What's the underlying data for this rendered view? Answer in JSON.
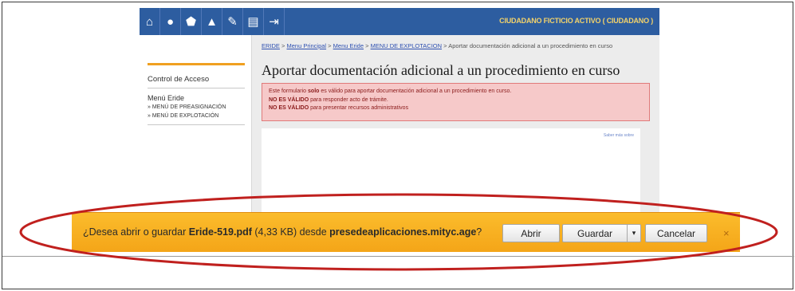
{
  "page": {
    "user_label": "CIUDADANO FICTICIO ACTIVO ( CIUDADANO )",
    "nav_icons": [
      "home-icon",
      "info-icon",
      "services-icon",
      "warning-icon",
      "edit-icon",
      "document-icon",
      "exit-icon"
    ],
    "nav_glyphs": [
      "⌂",
      "●",
      "⬟",
      "▲",
      "✎",
      "▤",
      "⇥"
    ]
  },
  "sidebar": {
    "access_control": "Control de Acceso",
    "menu_title": "Menú Eride",
    "menu_items": [
      "» MENÚ DE PREASIGNACIÓN",
      "» MENÚ DE EXPLOTACIÓN"
    ]
  },
  "breadcrumb": {
    "link1": "ERIDE",
    "link2": "Menu Principal",
    "link3": "Menu Eride",
    "link4": "MENU DE EXPLOTACION",
    "sep": " > ",
    "current": "Aportar documentación adicional a un procedimiento en curso"
  },
  "main": {
    "title": "Aportar documentación adicional a un procedimiento en curso",
    "alert": {
      "line1_pre": "Este formulario ",
      "line1_bold": "solo",
      "line1_post": " es válido para aportar documentación adicional a un procedimiento en curso.",
      "line2_bold": "NO ES VÁLIDO",
      "line2_post": " para responder acto de trámite.",
      "line3_bold": "NO ES VÁLIDO",
      "line3_post": " para presentar recursos administrativos"
    },
    "inner_link": "Saber más sobre"
  },
  "download_bar": {
    "prefix": "¿Desea abrir o guardar ",
    "filename": "Eride-519.pdf",
    "size": " (4,33 KB) desde ",
    "host": "presedeaplicaciones.mityc.age",
    "suffix": "?",
    "open_label": "Abrir",
    "save_label": "Guardar",
    "arrow": "▾",
    "cancel_label": "Cancelar",
    "close": "×"
  },
  "colors": {
    "topbar": "#2d5da0",
    "download_bar": "#f4a518",
    "ellipse": "#c0201e",
    "alert_bg": "#f6c9c9"
  }
}
